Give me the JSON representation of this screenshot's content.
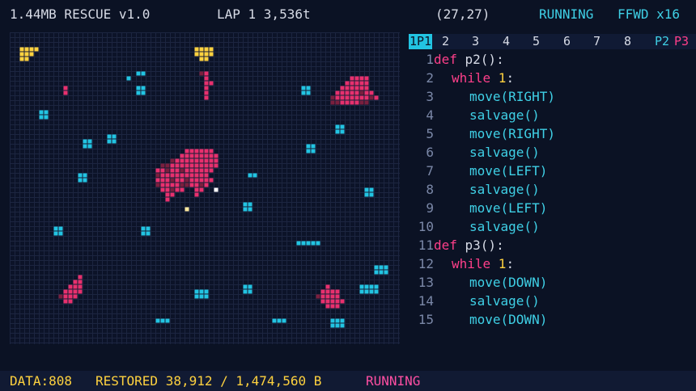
{
  "header": {
    "title": "1.44MB RESCUE v1.0",
    "lap": "LAP 1  3,536t",
    "coords": "(27,27)",
    "status": "RUNNING",
    "speed": "FFWD x16"
  },
  "tabs": [
    {
      "label": "1P1",
      "active": true
    },
    {
      "label": "2"
    },
    {
      "label": "3"
    },
    {
      "label": "4"
    },
    {
      "label": "5"
    },
    {
      "label": "6"
    },
    {
      "label": "7"
    },
    {
      "label": "8"
    },
    {
      "label": "P2",
      "color": "cyan"
    },
    {
      "label": "P3",
      "color": "pink"
    }
  ],
  "code": [
    {
      "n": "1",
      "indent": 0,
      "parts": [
        {
          "t": "def ",
          "c": "kw"
        },
        {
          "t": "p2():",
          "c": "fn"
        }
      ]
    },
    {
      "n": "2",
      "indent": 1,
      "parts": [
        {
          "t": "while ",
          "c": "kw"
        },
        {
          "t": "1",
          "c": "num"
        },
        {
          "t": ":",
          "c": "fn"
        }
      ]
    },
    {
      "n": "3",
      "indent": 2,
      "parts": [
        {
          "t": "move(RIGHT)",
          "c": "call"
        }
      ]
    },
    {
      "n": "4",
      "indent": 2,
      "parts": [
        {
          "t": "salvage()",
          "c": "call"
        }
      ]
    },
    {
      "n": "5",
      "indent": 2,
      "parts": [
        {
          "t": "move(RIGHT)",
          "c": "call"
        }
      ]
    },
    {
      "n": "6",
      "indent": 2,
      "parts": [
        {
          "t": "salvage()",
          "c": "call"
        }
      ]
    },
    {
      "n": "7",
      "indent": 2,
      "parts": [
        {
          "t": "move(LEFT)",
          "c": "call"
        }
      ]
    },
    {
      "n": "8",
      "indent": 2,
      "parts": [
        {
          "t": "salvage()",
          "c": "call"
        }
      ]
    },
    {
      "n": "9",
      "indent": 2,
      "parts": [
        {
          "t": "move(LEFT)",
          "c": "call"
        }
      ]
    },
    {
      "n": "10",
      "indent": 2,
      "parts": [
        {
          "t": "salvage()",
          "c": "call"
        }
      ]
    },
    {
      "n": "11",
      "indent": 0,
      "parts": [
        {
          "t": "def ",
          "c": "kw"
        },
        {
          "t": "p3():",
          "c": "fn"
        }
      ]
    },
    {
      "n": "12",
      "indent": 1,
      "parts": [
        {
          "t": "while ",
          "c": "kw"
        },
        {
          "t": "1",
          "c": "num"
        },
        {
          "t": ":",
          "c": "fn"
        }
      ]
    },
    {
      "n": "13",
      "indent": 2,
      "parts": [
        {
          "t": "move(DOWN)",
          "c": "call"
        }
      ]
    },
    {
      "n": "14",
      "indent": 2,
      "parts": [
        {
          "t": "salvage()",
          "c": "call"
        }
      ]
    },
    {
      "n": "15",
      "indent": 2,
      "parts": [
        {
          "t": "move(DOWN)",
          "c": "call"
        }
      ]
    }
  ],
  "statusbar": {
    "data": "DATA:808",
    "restored": "RESTORED 38,912 / 1,474,560 B",
    "running": "RUNNING"
  },
  "colors": {
    "cyan": "#22c4e2",
    "pink": "#e8306e",
    "darkpink": "#7a1f3e",
    "yellow": "#ffd23f"
  }
}
